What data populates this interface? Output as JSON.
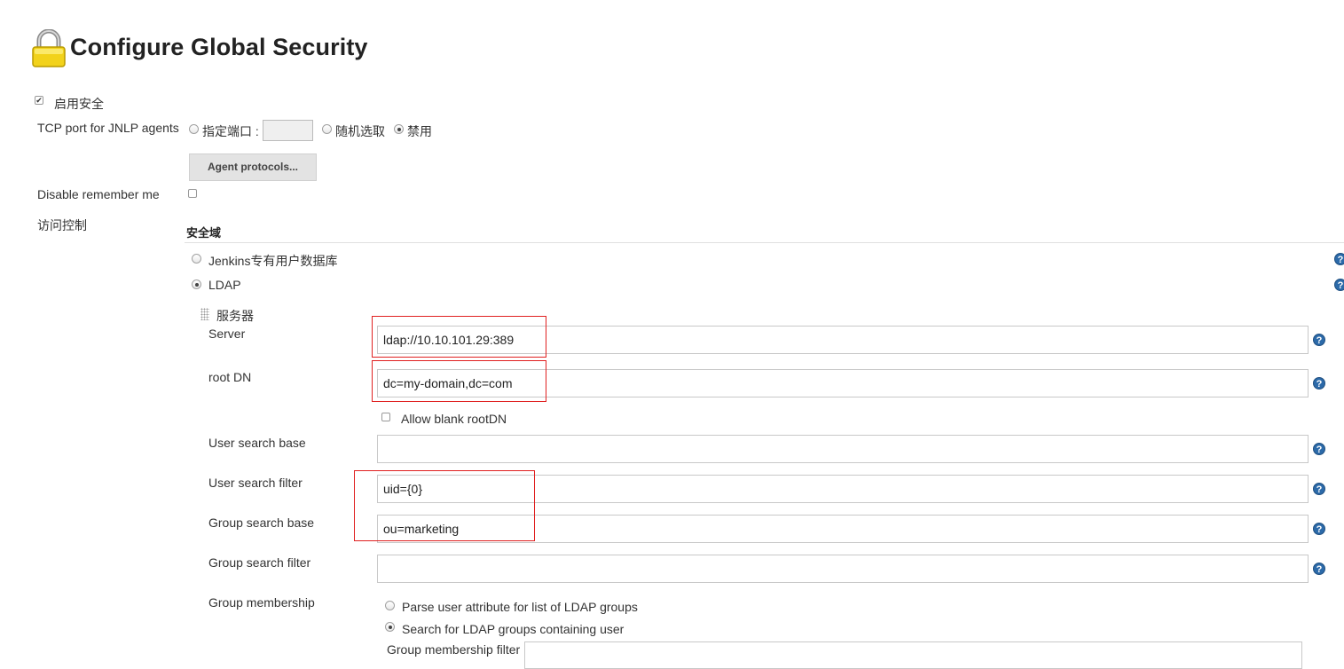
{
  "header": {
    "title": "Configure Global Security",
    "icon": "lock-icon"
  },
  "security": {
    "enable_label": "启用安全",
    "enable_checked": true,
    "tcp_port_label": "TCP port for JNLP agents",
    "tcp_options": [
      {
        "label": "指定端口 :",
        "selected": false
      },
      {
        "label": "随机选取",
        "selected": false
      },
      {
        "label": "禁用",
        "selected": true
      }
    ],
    "port_value": "",
    "agent_protocols_button": "Agent protocols...",
    "disable_remember_label": "Disable remember me",
    "disable_remember_checked": false,
    "access_control_label": "访问控制"
  },
  "realm": {
    "heading": "安全域",
    "options": [
      {
        "label": "Jenkins专有用户数据库",
        "selected": false
      },
      {
        "label": "LDAP",
        "selected": true
      }
    ]
  },
  "ldap": {
    "server_section_label": "服务器",
    "server_label": "Server",
    "server_value": "ldap://10.10.101.29:389",
    "root_dn_label": "root DN",
    "root_dn_value": "dc=my-domain,dc=com",
    "allow_blank_label": "Allow blank rootDN",
    "allow_blank_checked": false,
    "user_search_base_label": "User search base",
    "user_search_base_value": "",
    "user_search_filter_label": "User search filter",
    "user_search_filter_value": "uid={0}",
    "group_search_base_label": "Group search base",
    "group_search_base_value": "ou=marketing",
    "group_search_filter_label": "Group search filter",
    "group_search_filter_value": "",
    "group_membership_label": "Group membership",
    "membership_options": [
      {
        "label": "Parse user attribute for list of LDAP groups",
        "selected": false
      },
      {
        "label": "Search for LDAP groups containing user",
        "selected": true
      }
    ],
    "group_membership_filter_label": "Group membership filter",
    "group_membership_filter_value": ""
  },
  "help_icon": "?",
  "colors": {
    "help": "#2c6aa9",
    "highlight": "#e02020",
    "button_bg": "#e3e3e3"
  }
}
